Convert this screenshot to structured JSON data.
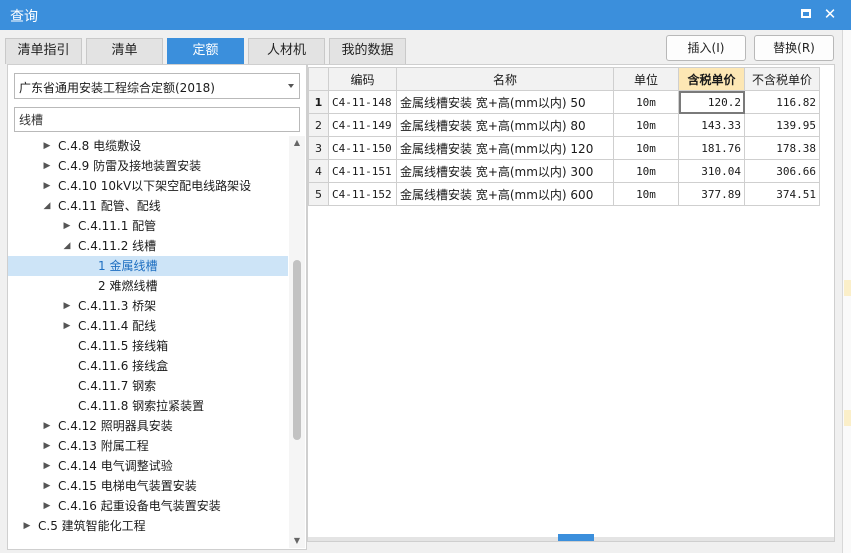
{
  "window": {
    "title": "查询"
  },
  "tabs": [
    {
      "label": "清单指引"
    },
    {
      "label": "清单"
    },
    {
      "label": "定额"
    },
    {
      "label": "人材机"
    },
    {
      "label": "我的数据"
    }
  ],
  "buttons": {
    "insert": "插入(I)",
    "replace": "替换(R)"
  },
  "left": {
    "quota_select": "广东省通用安装工程综合定额(2018)",
    "search_value": "线槽",
    "tree": [
      {
        "label": "C.4.8 电缆敷设",
        "level": 0,
        "expander": "collapsed"
      },
      {
        "label": "C.4.9 防雷及接地装置安装",
        "level": 0,
        "expander": "collapsed"
      },
      {
        "label": "C.4.10 10kV以下架空配电线路架设",
        "level": 0,
        "expander": "collapsed"
      },
      {
        "label": "C.4.11 配管、配线",
        "level": 0,
        "expander": "expanded"
      },
      {
        "label": "C.4.11.1 配管",
        "level": 1,
        "expander": "collapsed"
      },
      {
        "label": "C.4.11.2 线槽",
        "level": 1,
        "expander": "expanded"
      },
      {
        "label": "1 金属线槽",
        "level": 2,
        "expander": "none",
        "selected": true
      },
      {
        "label": "2 难燃线槽",
        "level": 2,
        "expander": "none"
      },
      {
        "label": "C.4.11.3 桥架",
        "level": 1,
        "expander": "collapsed"
      },
      {
        "label": "C.4.11.4 配线",
        "level": 1,
        "expander": "collapsed"
      },
      {
        "label": "C.4.11.5 接线箱",
        "level": 1,
        "expander": "none"
      },
      {
        "label": "C.4.11.6 接线盒",
        "level": 1,
        "expander": "none"
      },
      {
        "label": "C.4.11.7 钢索",
        "level": 1,
        "expander": "none"
      },
      {
        "label": "C.4.11.8 钢索拉紧装置",
        "level": 1,
        "expander": "none"
      },
      {
        "label": "C.4.12 照明器具安装",
        "level": 0,
        "expander": "collapsed"
      },
      {
        "label": "C.4.13 附属工程",
        "level": 0,
        "expander": "collapsed"
      },
      {
        "label": "C.4.14 电气调整试验",
        "level": 0,
        "expander": "collapsed"
      },
      {
        "label": "C.4.15 电梯电气装置安装",
        "level": 0,
        "expander": "collapsed"
      },
      {
        "label": "C.4.16 起重设备电气装置安装",
        "level": 0,
        "expander": "collapsed"
      },
      {
        "label": "C.5 建筑智能化工程",
        "level": -1,
        "expander": "collapsed"
      }
    ]
  },
  "grid": {
    "headers": {
      "code": "编码",
      "name": "名称",
      "unit": "单位",
      "tax_price": "含税单价",
      "notax_price": "不含税单价"
    },
    "rows": [
      {
        "no": "1",
        "code": "C4-11-148",
        "name": "金属线槽安装 宽+高(mm以内) 50",
        "unit": "10m",
        "tax_price": "120.2",
        "notax_price": "116.82"
      },
      {
        "no": "2",
        "code": "C4-11-149",
        "name": "金属线槽安装 宽+高(mm以内) 80",
        "unit": "10m",
        "tax_price": "143.33",
        "notax_price": "139.95"
      },
      {
        "no": "3",
        "code": "C4-11-150",
        "name": "金属线槽安装 宽+高(mm以内) 120",
        "unit": "10m",
        "tax_price": "181.76",
        "notax_price": "178.38"
      },
      {
        "no": "4",
        "code": "C4-11-151",
        "name": "金属线槽安装 宽+高(mm以内) 300",
        "unit": "10m",
        "tax_price": "310.04",
        "notax_price": "306.66"
      },
      {
        "no": "5",
        "code": "C4-11-152",
        "name": "金属线槽安装 宽+高(mm以内) 600",
        "unit": "10m",
        "tax_price": "377.89",
        "notax_price": "374.51"
      }
    ]
  },
  "colors": {
    "accent": "#3b8fdc",
    "header_highlight": "#fde7b4",
    "selected_node": "#cde4f7"
  }
}
